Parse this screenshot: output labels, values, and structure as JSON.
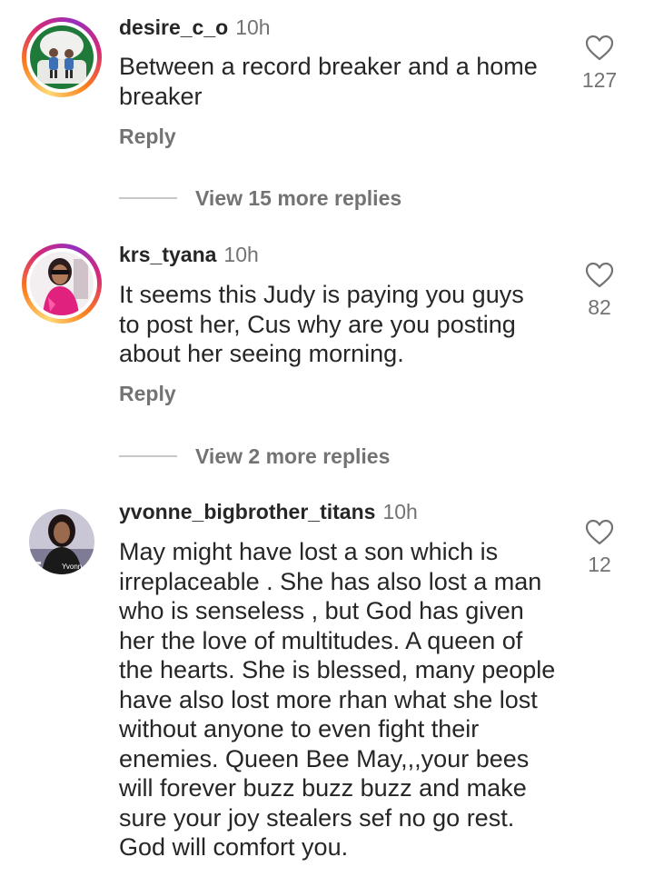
{
  "comments": [
    {
      "username": "desire_c_o",
      "time": "10h",
      "text": "Between a record breaker and a home breaker",
      "reply_label": "Reply",
      "likes": "127",
      "view_more": "View 15 more replies"
    },
    {
      "username": "krs_tyana",
      "time": "10h",
      "text": "It seems this Judy is paying you guys to post her, Cus why are you posting about her seeing morning.",
      "reply_label": "Reply",
      "likes": "82",
      "view_more": "View 2 more replies"
    },
    {
      "username": "yvonne_bigbrother_titans",
      "time": "10h",
      "text": "May might have lost a son which is irreplaceable . She has also lost a man who is senseless , but God has given her the love of multitudes. A queen of the hearts. She is blessed, many people have also lost more rhan what she lost without anyone to even fight their enemies. Queen Bee May,,,your bees will forever buzz buzz buzz and make sure your joy stealers sef no go rest. God will comfort you.",
      "likes": "12",
      "avatar_caption": "Yvonn"
    }
  ],
  "icons": {
    "like": "heart-outline-icon"
  },
  "colors": {
    "text": "#262626",
    "secondary": "#737373",
    "divider": "#c7c7c7"
  }
}
